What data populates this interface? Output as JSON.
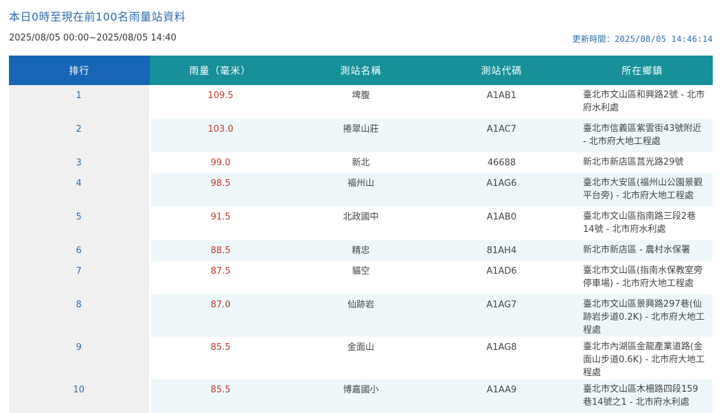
{
  "page": {
    "title": "本日0時至現在前100名雨量站資料",
    "date_range": "2025/08/05 00:00~2025/08/05 14:40",
    "update_time": "更新時間：2025/08/05 14:46:14"
  },
  "table": {
    "headers": {
      "rank": "排行",
      "rainfall": "雨量（毫米）",
      "station_name": "測站名稱",
      "station_code": "測站代碼",
      "location": "所在鄉鎮"
    },
    "rows": [
      {
        "rank": "1",
        "rainfall": "109.5",
        "name": "埤腹",
        "code": "A1AB1",
        "location": "臺北市文山區和興路2號 - 北市府水利處"
      },
      {
        "rank": "2",
        "rainfall": "103.0",
        "name": "捲翠山莊",
        "code": "A1AC7",
        "location": "臺北市信義區紫雲街43號附近 - 北市府大地工程處"
      },
      {
        "rank": "3",
        "rainfall": "99.0",
        "name": "新北",
        "code": "46688",
        "location": "新北市新店區莒光路29號"
      },
      {
        "rank": "4",
        "rainfall": "98.5",
        "name": "福州山",
        "code": "A1AG6",
        "location": "臺北市大安區(福州山公園景觀平台旁) - 北市府大地工程處"
      },
      {
        "rank": "5",
        "rainfall": "91.5",
        "name": "北政國中",
        "code": "A1AB0",
        "location": "臺北市文山區指南路三段2巷14號 - 北市府水利處"
      },
      {
        "rank": "6",
        "rainfall": "88.5",
        "name": "精忠",
        "code": "81AH4",
        "location": "新北市新店區 - 農村水保署"
      },
      {
        "rank": "7",
        "rainfall": "87.5",
        "name": "貓空",
        "code": "A1AD6",
        "location": "臺北市文山區(指南水保教室旁停車場) - 北市府大地工程處"
      },
      {
        "rank": "8",
        "rainfall": "87.0",
        "name": "仙跡岩",
        "code": "A1AG7",
        "location": "臺北市文山區景興路297巷(仙跡岩步道0.2K) - 北市府大地工程處"
      },
      {
        "rank": "9",
        "rainfall": "85.5",
        "name": "金面山",
        "code": "A1AG8",
        "location": "臺北市內湖區金龍產業道路(金面山步道0.6K) - 北市府大地工程處"
      },
      {
        "rank": "10",
        "rainfall": "85.5",
        "name": "博嘉國小",
        "code": "A1AA9",
        "location": "臺北市文山區木柵路四段159巷14號之1 - 北市府水利處"
      }
    ]
  },
  "colors": {
    "title": "#2a6cb0",
    "header_rank_bg": "#1766b6",
    "header_bg": "#17909a",
    "rainfall_text": "#c0392b",
    "rank_bg": "#f0f0f0",
    "row_alt_bg": "#eef8fb"
  }
}
